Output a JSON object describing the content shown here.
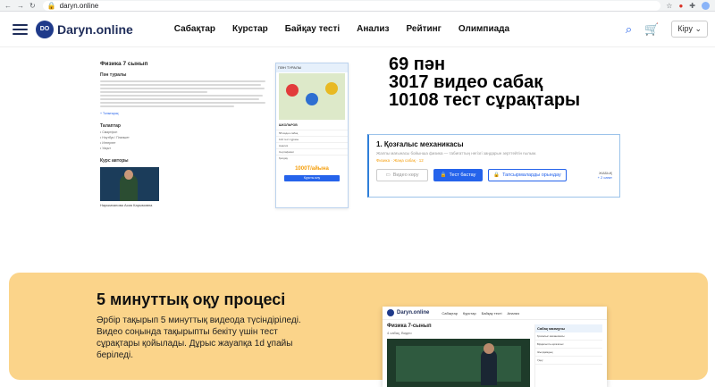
{
  "browser": {
    "url": "daryn.online"
  },
  "site": {
    "logo_mark": "DO",
    "name": "Daryn.online",
    "menu": [
      "Сабақтар",
      "Курстар",
      "Байқау тесті",
      "Анализ",
      "Рейтинг",
      "Олимпиада"
    ],
    "login": "Кіру ⌄"
  },
  "preview": {
    "title": "Физика 7 сынып",
    "about": "Пән туралы",
    "more": "+ Толығырақ",
    "requirements": "Талаптар",
    "bullets": [
      "• Смартфон",
      "• Ноутбук / Планшет",
      "• Интернет",
      "• Уақыт"
    ],
    "authors": "Курс авторы",
    "teacher_name": "Нарымханова Асия Карымовна",
    "card_top": "ПӘН ТУРАЛЫ",
    "card_sub": "ШКОЛЬРОВ",
    "card_rows": [
      "58 видео сабақ",
      "124 тест сұрағы",
      "Анализ",
      "Сертификат",
      "Қолдау"
    ],
    "price": "1000T/айына",
    "buy": "Курсты алу"
  },
  "stats": {
    "line1": "69 пән",
    "line2": "3017 видео сабақ",
    "line3": "10108 тест сұрақтары"
  },
  "lesson": {
    "title": "1. Қозғалыс механикасы",
    "desc": "Жалпы мағынасы бойынша физика — табиғаттың негізгі заңдарын зерттейтін ғылым.",
    "meta": "Физика · Жаңа сабақ · 12",
    "btn_video": "Видео көру",
    "btn_test": "Тест бастау",
    "btn_tasks": "Тапсырмаларды орындау",
    "closed_label": "ЖАБЫҚ",
    "closed_sub": "+ 2 сағат"
  },
  "process": {
    "title": "5 минуттық оқу процесі",
    "text": "Әрбір тақырып 5 минуттық видеода түсіндіріледі. Видео соңында тақырыпты бекіту үшін тест сұрақтары қойылады. Дұрыс жауапқа 1d ұпайы беріледі.",
    "shot_name": "Daryn.online",
    "shot_menu": [
      "Сабақтар",
      "Курстар",
      "Байқау тесті",
      "Анализ"
    ],
    "shot_title": "Физика 7-сынып",
    "shot_sub": "4 сабақ, Видео",
    "side_hdr": "Сабақ мазмұны",
    "side_items": [
      "Қозғалыс механикасы",
      "Бірқалыпты қозғалыс",
      "Жылдамдық",
      "Үдеу"
    ]
  },
  "colors": {
    "brand": "#1f3a8a",
    "accent": "#2563eb",
    "section_bg": "#fbd48a"
  }
}
